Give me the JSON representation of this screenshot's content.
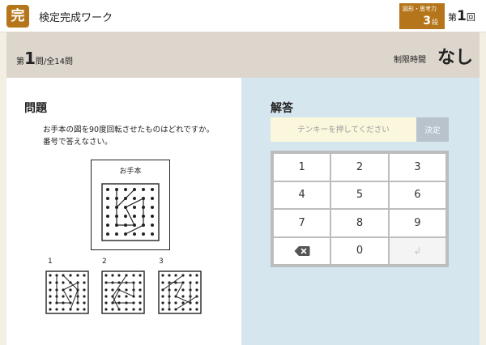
{
  "header": {
    "app_badge": "完",
    "title": "検定完成ワーク",
    "category": "図形・思考力",
    "level_number": "3",
    "level_unit": "段",
    "round_prefix": "第",
    "round_number": "1",
    "round_suffix": "回"
  },
  "progress": {
    "prefix": "第",
    "current": "1",
    "mid": "問/全",
    "total": "14",
    "suffix": "問",
    "time_label": "制限時間",
    "time_value": "なし"
  },
  "question": {
    "heading": "問題",
    "text_line1": "お手本の図を90度回転させたものはどれですか。",
    "text_line2": "番号で答えなさい。",
    "model_label": "お手本",
    "options": [
      "1",
      "2",
      "3"
    ]
  },
  "answer": {
    "heading": "解答",
    "placeholder": "テンキーを押してください",
    "submit_label": "決定",
    "keys": [
      "1",
      "2",
      "3",
      "4",
      "5",
      "6",
      "7",
      "8",
      "9",
      "0"
    ]
  },
  "icons": {
    "backspace": "backspace-icon",
    "enter": "enter-icon"
  },
  "colors": {
    "brand": "#b5761b",
    "answer_bg": "#d6e6ef",
    "info_bg": "#ddd6cc",
    "input_bg": "#fbf7dd",
    "submit_bg": "#b8c3cc"
  }
}
